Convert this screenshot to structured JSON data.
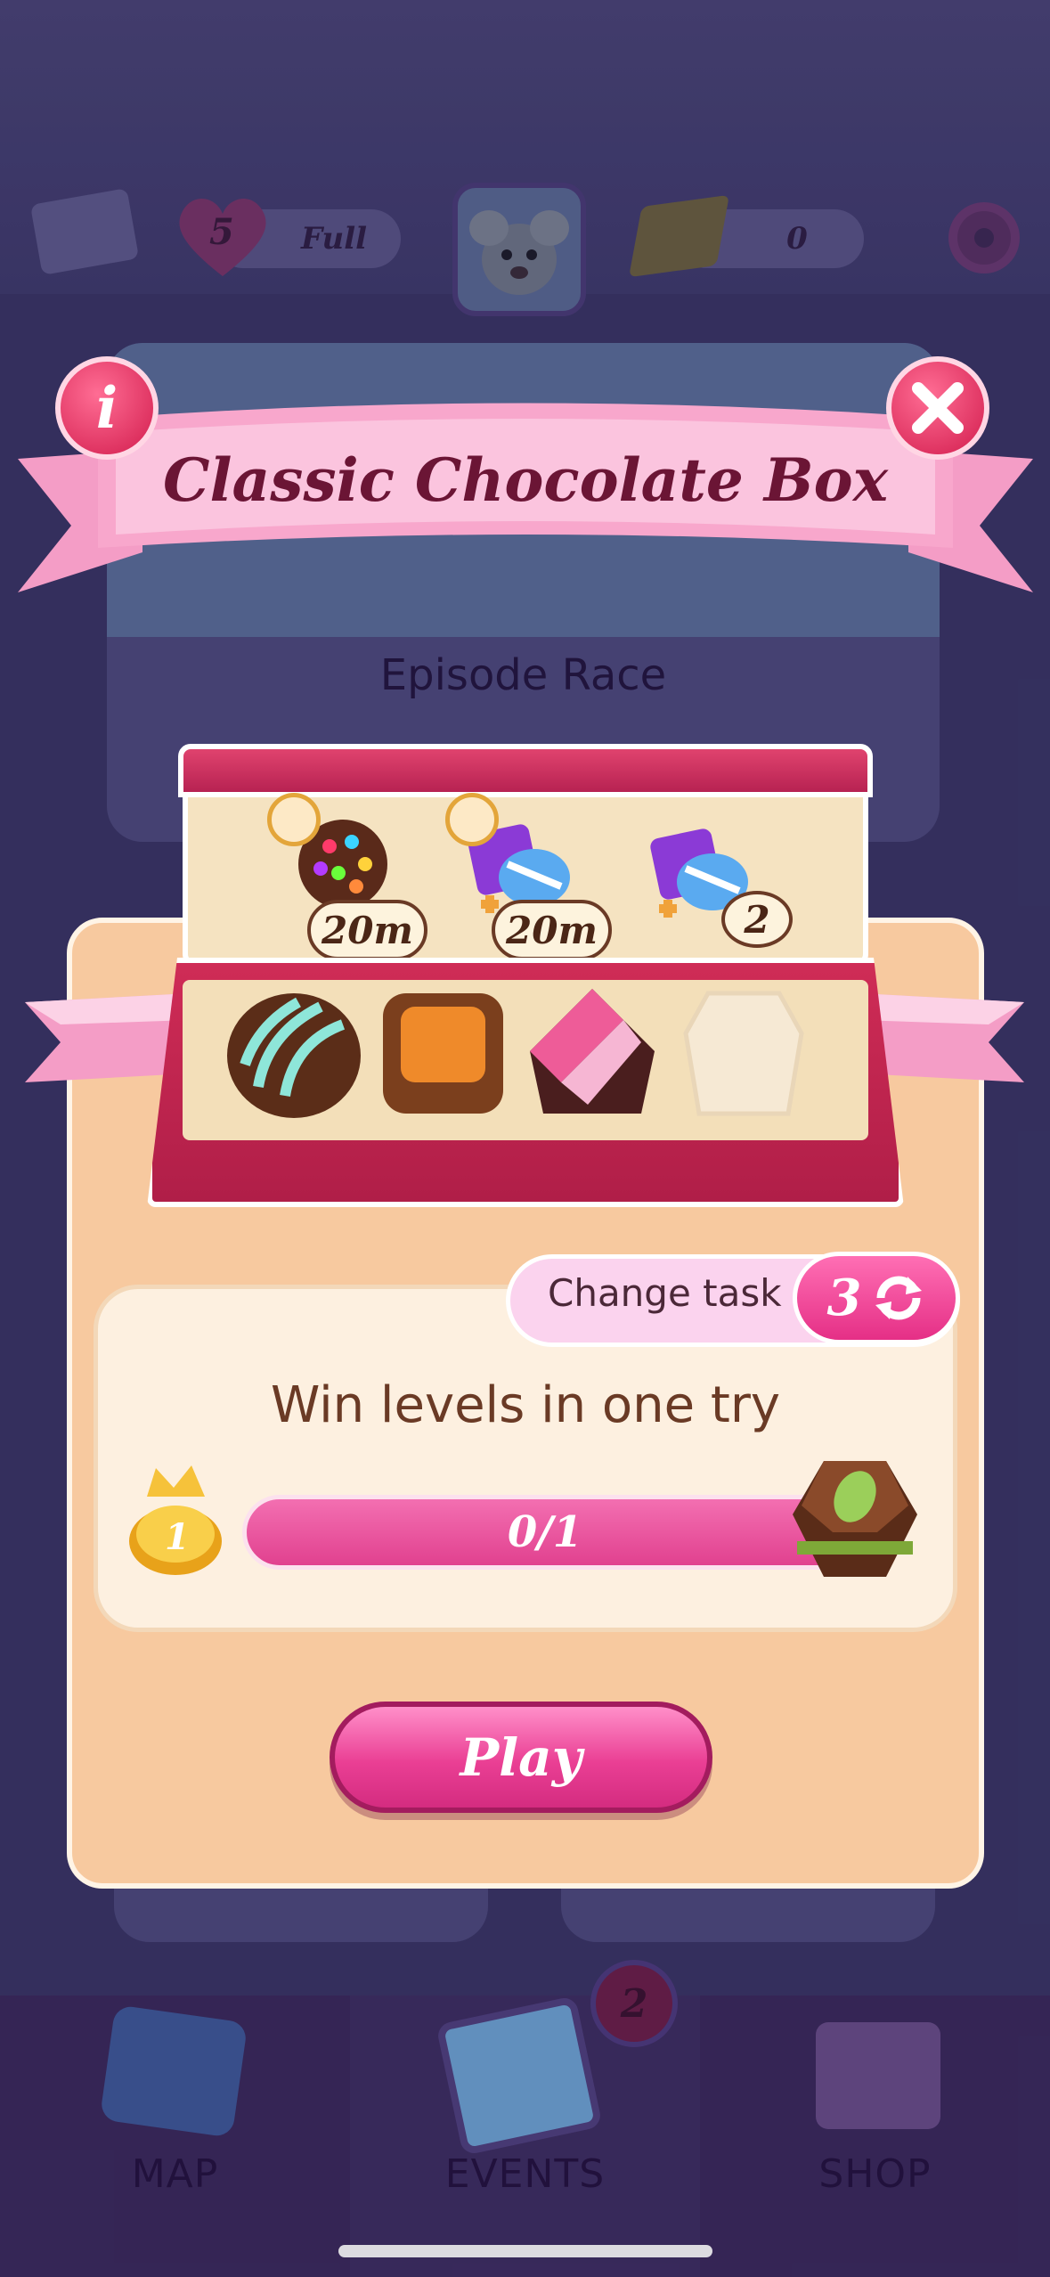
{
  "hud": {
    "lives_count": "5",
    "lives_status": "Full",
    "gold_count": "0"
  },
  "popup": {
    "title": "Classic Chocolate Box",
    "info_symbol": "i",
    "rewards": [
      {
        "name": "color-bomb-timed",
        "label": "20m"
      },
      {
        "name": "striped-wrapped-timed",
        "label": "20m"
      },
      {
        "name": "striped-wrapped-booster",
        "label": "2"
      }
    ],
    "chocolates_collected": 3,
    "chocolates_total": 4,
    "change_task_label": "Change task",
    "change_task_count": "3",
    "task_title": "Win levels in one try",
    "task_level": "1",
    "progress_text": "0/1",
    "progress_fraction": 0,
    "play_label": "Play"
  },
  "background": {
    "card_title": "Episode Race"
  },
  "nav": {
    "map_label": "MAP",
    "events_label": "EVENTS",
    "events_badge": "2",
    "shop_label": "SHOP"
  },
  "colors": {
    "accent_pink": "#e1418f",
    "banner_text": "#6b1535",
    "panel_bg": "#f7c99f"
  }
}
